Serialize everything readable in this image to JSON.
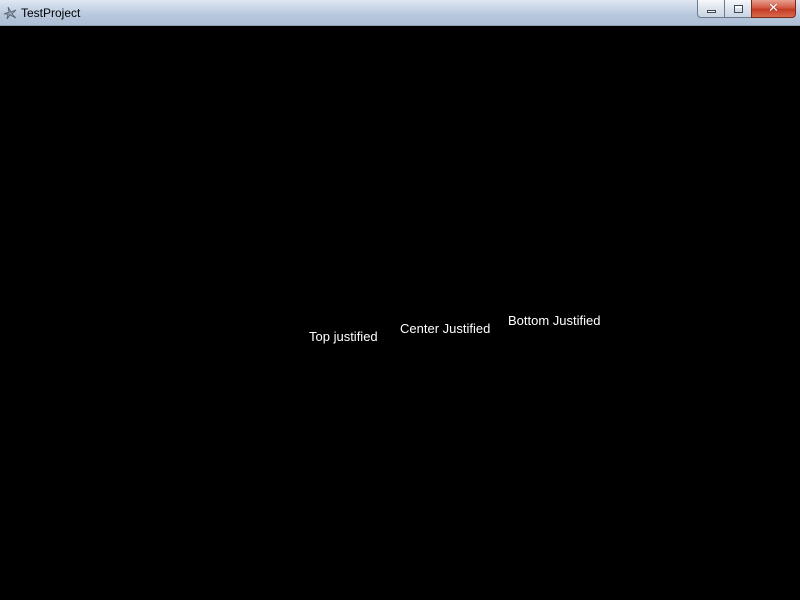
{
  "window": {
    "title": "TestProject",
    "icon": "app-icon",
    "controls": {
      "minimize_icon": "minimize-icon",
      "maximize_icon": "maximize-icon",
      "close_icon": "close-icon",
      "close_glyph": "✕"
    }
  },
  "client": {
    "background_color": "#000000",
    "text_color": "#ffffff",
    "labels": {
      "top": "Top justified",
      "center": "Center Justified",
      "bottom": "Bottom Justified"
    }
  }
}
